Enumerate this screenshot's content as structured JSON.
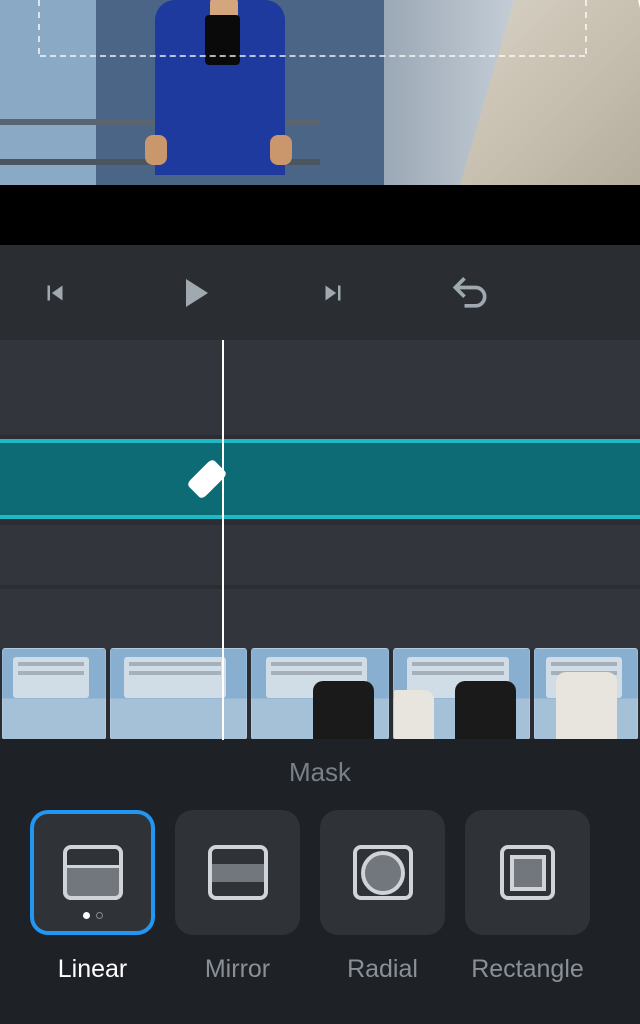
{
  "panel": {
    "title": "Mask"
  },
  "mask_options": [
    {
      "label": "Linear",
      "selected": true
    },
    {
      "label": "Mirror",
      "selected": false
    },
    {
      "label": "Radial",
      "selected": false
    },
    {
      "label": "Rectangle",
      "selected": false
    }
  ],
  "playback": {
    "prev": "previous-frame",
    "play": "play",
    "next": "next-frame",
    "undo": "undo"
  },
  "colors": {
    "accent": "#2196f3",
    "track": "#1fb8c4"
  }
}
